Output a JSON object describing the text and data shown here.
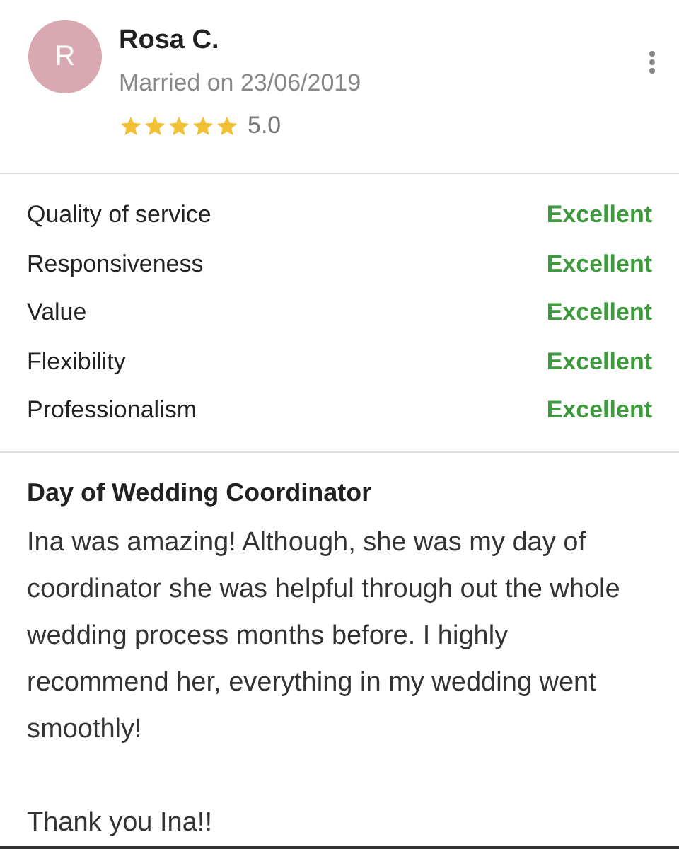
{
  "review": {
    "avatar_initial": "R",
    "name": "Rosa C.",
    "married": "Married on 23/06/2019",
    "stars": 5,
    "score": "5.0"
  },
  "ratings": [
    {
      "label": "Quality of service",
      "value": "Excellent"
    },
    {
      "label": "Responsiveness",
      "value": "Excellent"
    },
    {
      "label": "Value",
      "value": "Excellent"
    },
    {
      "label": "Flexibility",
      "value": "Excellent"
    },
    {
      "label": "Professionalism",
      "value": "Excellent"
    }
  ],
  "title": "Day of Wedding Coordinator",
  "paragraphs": [
    "Ina was amazing! Although, she was my day of coordinator she was helpful through out the whole wedding process months before. I highly recommend her, everything in my wedding went smoothly!",
    "Thank you Ina!!"
  ]
}
